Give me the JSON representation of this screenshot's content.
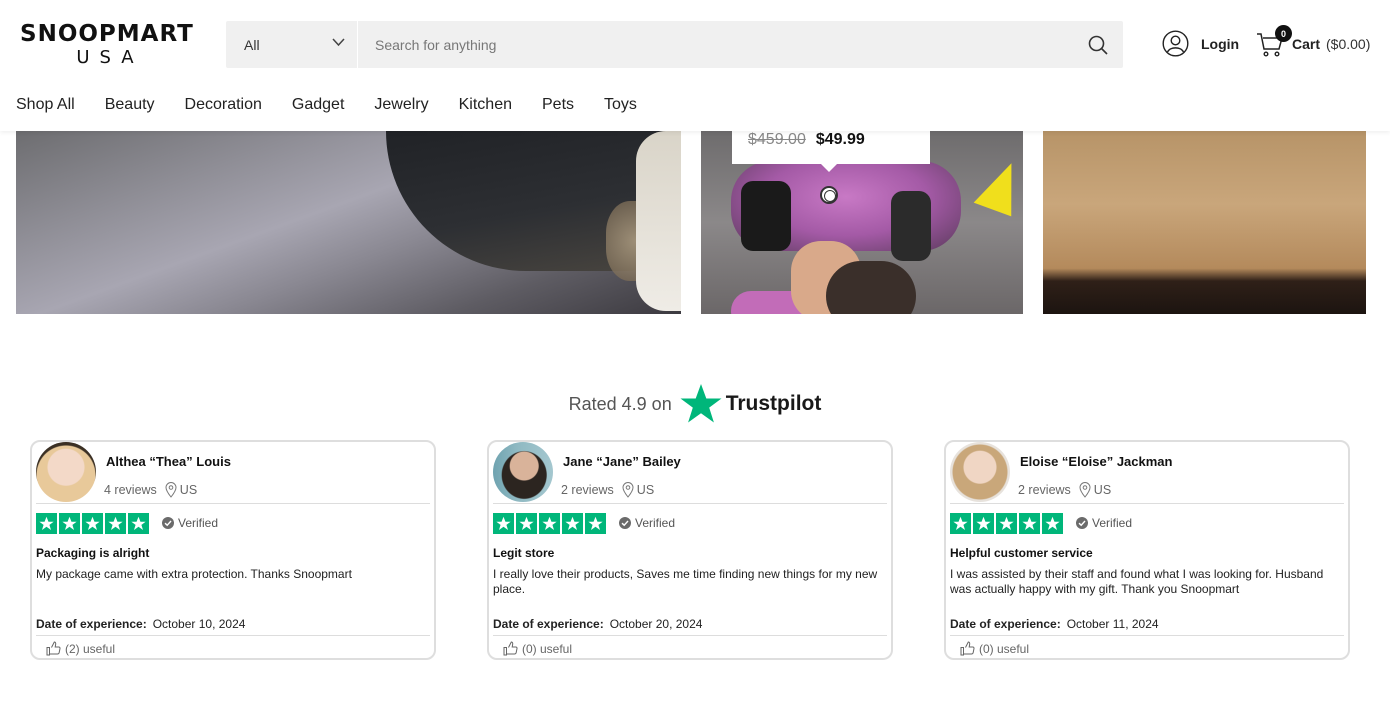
{
  "brand": {
    "name": "SNOOPMART",
    "sub": "USA"
  },
  "search": {
    "category": "All",
    "placeholder": "Search for anything"
  },
  "account": {
    "login_label": "Login"
  },
  "cart": {
    "count": "0",
    "label": "Cart",
    "total": "($0.00)"
  },
  "nav": [
    "Shop All",
    "Beauty",
    "Decoration",
    "Gadget",
    "Jewelry",
    "Kitchen",
    "Pets",
    "Toys"
  ],
  "product_tip": {
    "old_price": "$459.00",
    "new_price": "$49.99"
  },
  "trustpilot": {
    "rated_text": "Rated 4.9 on",
    "brand": "Trustpilot"
  },
  "reviews": [
    {
      "name": "Althea “Thea” Louis",
      "reviews_count": "4 reviews",
      "location": "US",
      "verified": "Verified",
      "title": "Packaging is alright",
      "body": "My package came with extra protection. Thanks Snoopmart",
      "date_label": "Date of experience:",
      "date": "October 10, 2024",
      "useful": "(2) useful"
    },
    {
      "name": "Jane “Jane” Bailey",
      "reviews_count": "2 reviews",
      "location": "US",
      "verified": "Verified",
      "title": "Legit store",
      "body": "I really love their products, Saves me time finding new things for my new place.",
      "date_label": "Date of experience:",
      "date": "October 20, 2024",
      "useful": "(0) useful"
    },
    {
      "name": "Eloise “Eloise” Jackman",
      "reviews_count": "2 reviews",
      "location": "US",
      "verified": "Verified",
      "title": "Helpful customer service",
      "body": "I was assisted by their staff and found what I was looking for. Husband was actually happy with my gift. Thank you Snoopmart",
      "date_label": "Date of experience:",
      "date": "October 11, 2024",
      "useful": "(0) useful"
    }
  ],
  "colors": {
    "trustpilot_green": "#00b67a",
    "text": "#111111",
    "search_bg": "#f0f0f0"
  },
  "icons": [
    "chevron-down-icon",
    "search-icon",
    "user-icon",
    "cart-icon",
    "trustpilot-star-icon",
    "location-pin-icon",
    "verified-check-icon",
    "thumbs-up-icon"
  ]
}
